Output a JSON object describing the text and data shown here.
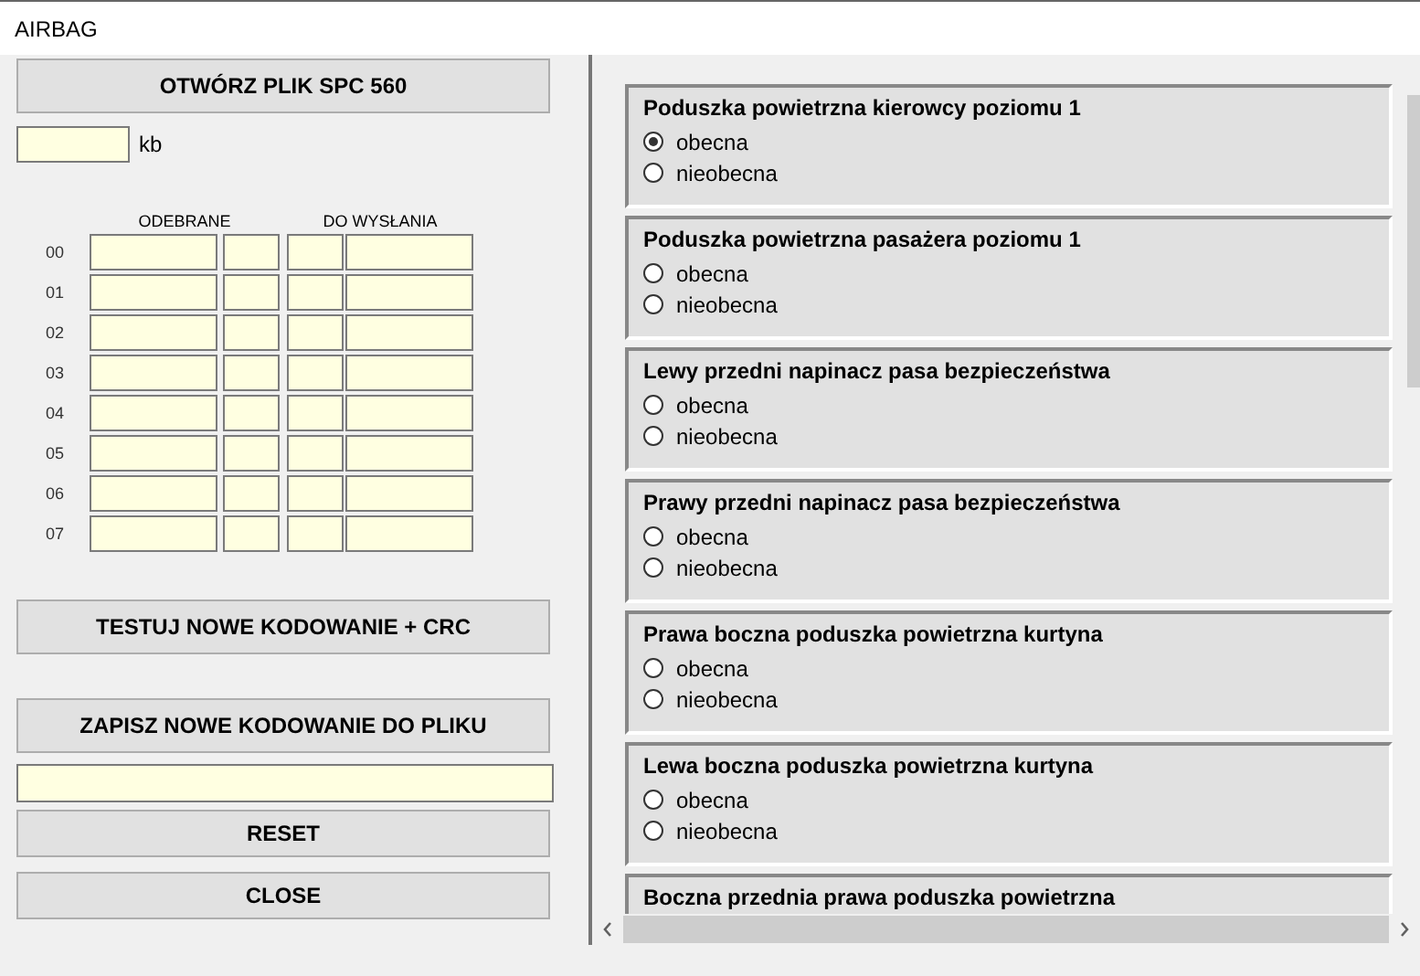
{
  "window": {
    "title": "AIRBAG"
  },
  "open_button": "OTWÓRZ PLIK SPC 560",
  "size_unit": "kb",
  "grid": {
    "received_label": "ODEBRANE",
    "to_send_label": "DO WYSŁANIA",
    "rows": [
      "00",
      "01",
      "02",
      "03",
      "04",
      "05",
      "06",
      "07"
    ]
  },
  "test_button": "TESTUJ NOWE KODOWANIE + CRC",
  "save_button": "ZAPISZ NOWE KODOWANIE DO PLIKU",
  "reset_button": "RESET",
  "close_button": "CLOSE",
  "groups": [
    {
      "title": "Poduszka powietrzna kierowcy poziomu 1",
      "options": [
        {
          "label": "obecna",
          "selected": true
        },
        {
          "label": "nieobecna",
          "selected": false
        }
      ]
    },
    {
      "title": "Poduszka powietrzna pasażera poziomu 1",
      "options": [
        {
          "label": "obecna",
          "selected": false
        },
        {
          "label": "nieobecna",
          "selected": false
        }
      ]
    },
    {
      "title": "Lewy przedni napinacz pasa bezpieczeństwa",
      "options": [
        {
          "label": "obecna",
          "selected": false
        },
        {
          "label": "nieobecna",
          "selected": false
        }
      ]
    },
    {
      "title": "Prawy przedni napinacz pasa bezpieczeństwa",
      "options": [
        {
          "label": "obecna",
          "selected": false
        },
        {
          "label": "nieobecna",
          "selected": false
        }
      ]
    },
    {
      "title": "Prawa boczna poduszka powietrzna kurtyna",
      "options": [
        {
          "label": "obecna",
          "selected": false
        },
        {
          "label": "nieobecna",
          "selected": false
        }
      ]
    },
    {
      "title": "Lewa boczna poduszka powietrzna kurtyna",
      "options": [
        {
          "label": "obecna",
          "selected": false
        },
        {
          "label": "nieobecna",
          "selected": false
        }
      ]
    },
    {
      "title": "Boczna przednia prawa poduszka powietrzna"
    }
  ]
}
